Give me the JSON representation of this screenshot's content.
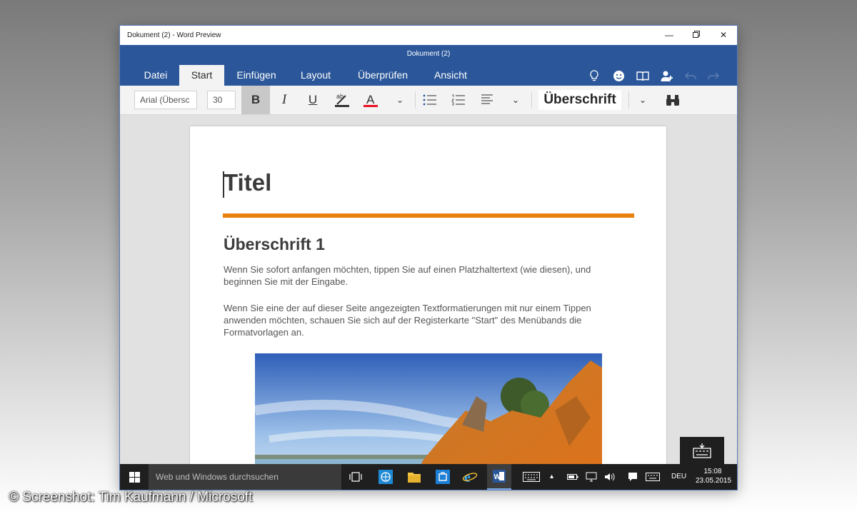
{
  "window": {
    "title": "Dokument (2) - Word Preview",
    "doc_name": "Dokument (2)"
  },
  "ribbon": {
    "tabs": [
      "Datei",
      "Start",
      "Einfügen",
      "Layout",
      "Überprüfen",
      "Ansicht"
    ],
    "active_tab": "Start"
  },
  "toolbar": {
    "font_name": "Arial (Übersc",
    "font_size": "30",
    "style": "Überschrift",
    "bold": "B",
    "italic": "I",
    "underline": "U",
    "highlight": "ab",
    "font_color": "A"
  },
  "document": {
    "title": "Titel",
    "heading1": "Überschrift 1",
    "para1": "Wenn Sie sofort anfangen möchten, tippen Sie auf einen Platzhaltertext (wie diesen), und beginnen Sie mit der Eingabe.",
    "para2": "Wenn Sie eine der auf dieser Seite angezeigten Textformatierungen mit nur einem Tippen anwenden möchten, schauen Sie sich auf der Registerkarte \"Start\" des Menübands die Formatvorlagen an.",
    "accent_color": "#e8820c"
  },
  "taskbar": {
    "search_placeholder": "Web und Windows durchsuchen",
    "language": "DEU",
    "time": "15:08",
    "date": "23.05.2015"
  },
  "credit": "© Screenshot: Tim Kaufmann / Microsoft",
  "colors": {
    "brand": "#2b579a",
    "taskbar": "#1f1f1f"
  }
}
